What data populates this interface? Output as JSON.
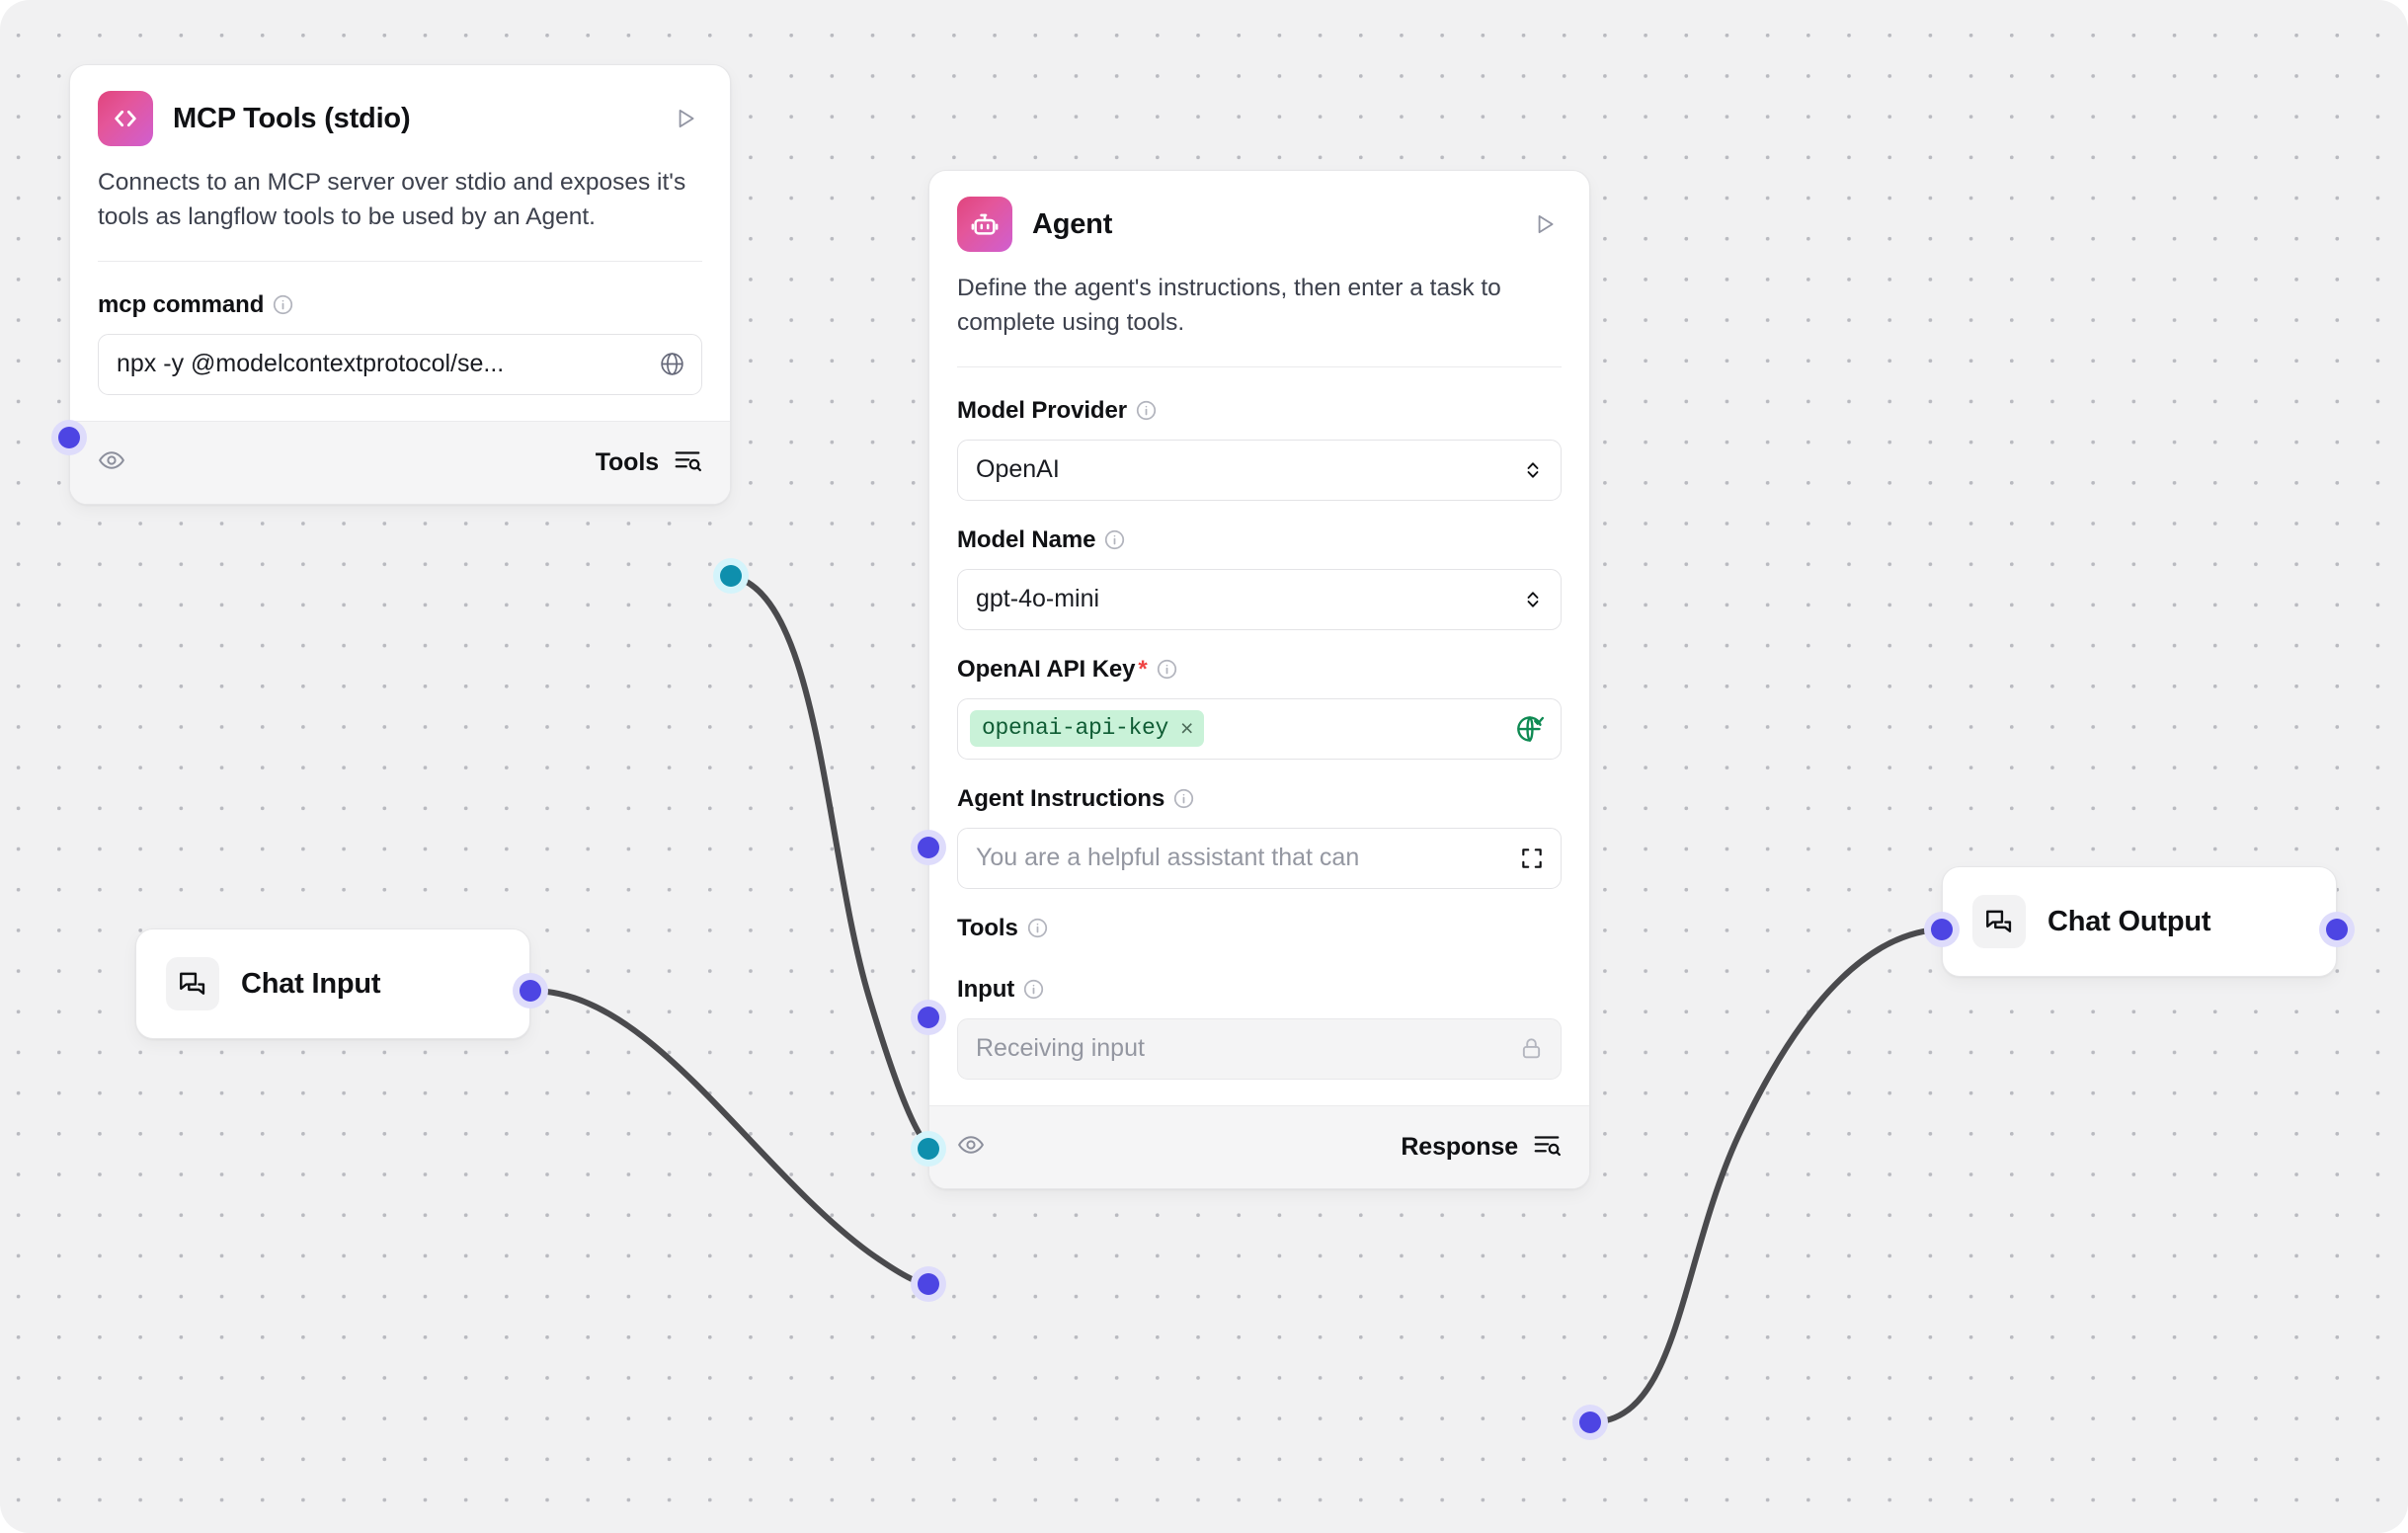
{
  "canvas": {
    "background_color": "#f1f1f2",
    "grid_dot_color": "#b9bac0",
    "edge_color": "#4a4a4d",
    "port_purple": "#4d45e3",
    "port_teal": "#0e8fad"
  },
  "nodes": {
    "mcp_tools": {
      "title": "MCP Tools (stdio)",
      "icon": "code-brackets-icon",
      "description": "Connects to an MCP server over stdio and exposes it's tools as langflow tools to be used by an Agent.",
      "fields": [
        {
          "label": "mcp command",
          "value": "npx -y @modelcontextprotocol/se...",
          "trailing_icon": "globe-icon"
        }
      ],
      "footer": {
        "eye_icon": "eye-icon",
        "output_label": "Tools",
        "output_icon": "list-search-icon"
      }
    },
    "agent": {
      "title": "Agent",
      "icon": "bot-icon",
      "description": "Define the agent's instructions, then enter a task to complete using tools.",
      "fields": {
        "model_provider": {
          "label": "Model Provider",
          "value": "OpenAI"
        },
        "model_name": {
          "label": "Model Name",
          "value": "gpt-4o-mini"
        },
        "api_key": {
          "label": "OpenAI API Key",
          "required_marker": "*",
          "chip": "openai-api-key",
          "chip_remove": "×",
          "trailing_icon": "globe-check-icon"
        },
        "agent_instructions": {
          "label": "Agent Instructions",
          "placeholder": "You are a helpful assistant that can",
          "trailing_icon": "expand-icon"
        },
        "tools": {
          "label": "Tools"
        },
        "input": {
          "label": "Input",
          "placeholder": "Receiving input",
          "trailing_icon": "lock-icon"
        }
      },
      "footer": {
        "eye_icon": "eye-icon",
        "output_label": "Response",
        "output_icon": "list-search-icon"
      }
    },
    "chat_input": {
      "title": "Chat Input",
      "icon": "chat-bubbles-icon"
    },
    "chat_output": {
      "title": "Chat Output",
      "icon": "chat-bubbles-icon"
    }
  }
}
